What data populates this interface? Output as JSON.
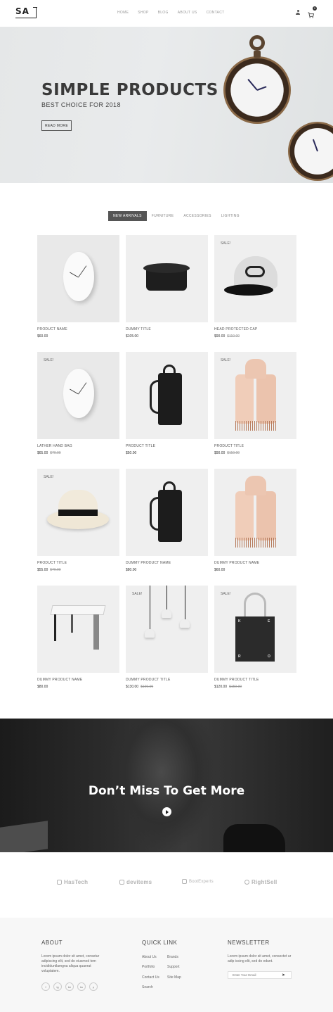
{
  "header": {
    "logo": "SA",
    "nav": [
      "HOME",
      "SHOP",
      "BLOG",
      "ABOUT US",
      "CONTACT"
    ],
    "cart_count": "0"
  },
  "hero": {
    "title": "SIMPLE PRODUCTS",
    "subtitle": "BEST CHOICE FOR 2018",
    "button": "READ MORE"
  },
  "tabs": [
    "NEW ARRIVALS",
    "FURNITURE",
    "ACCESSORIES",
    "LIGHTING"
  ],
  "products": [
    {
      "name": "PRODUCT NAME",
      "price": "$60.00",
      "old_price": "",
      "sale": "",
      "art": "clock"
    },
    {
      "name": "DUMMY TITLE",
      "price": "$105.00",
      "old_price": "",
      "sale": "",
      "art": "speaker"
    },
    {
      "name": "HEAD PROTECTED CAP",
      "price": "$90.00",
      "old_price": "$110.00",
      "sale": "SALE!",
      "art": "cap"
    },
    {
      "name": "LATHER HAND BAG",
      "price": "$65.00",
      "old_price": "$70.00",
      "sale": "SALE!",
      "art": "clock"
    },
    {
      "name": "PRODUCT TITLE",
      "price": "$50.00",
      "old_price": "",
      "sale": "",
      "art": "backpack"
    },
    {
      "name": "PRODUCT TITLE",
      "price": "$90.00",
      "old_price": "$110.00",
      "sale": "SALE!",
      "art": "scarf"
    },
    {
      "name": "PRODUCT TITLE",
      "price": "$55.00",
      "old_price": "$70.00",
      "sale": "SALE!",
      "art": "hat"
    },
    {
      "name": "DUMMY PRODUCT NAME",
      "price": "$80.00",
      "old_price": "",
      "sale": "",
      "art": "backpack"
    },
    {
      "name": "DUMMY PRODUCT NAME",
      "price": "$60.00",
      "old_price": "",
      "sale": "",
      "art": "scarf"
    },
    {
      "name": "DUMMY PRODUCT NAME",
      "price": "$80.00",
      "old_price": "",
      "sale": "",
      "art": "stool"
    },
    {
      "name": "DUMMY PRODUCT TITLE",
      "price": "$130.00",
      "old_price": "$160.00",
      "sale": "SALE!",
      "art": "lamps"
    },
    {
      "name": "DUMMY PRODUCT TITLE",
      "price": "$120.00",
      "old_price": "$150.00",
      "sale": "SALE!",
      "art": "tote"
    }
  ],
  "promo": {
    "title": "Don’t Miss To Get More"
  },
  "brands": [
    "HasTech",
    "devitems",
    "BootExperts",
    "RightSell"
  ],
  "footer": {
    "about": {
      "heading": "ABOUT",
      "text": "Lorem ipsum dolor sit amet, consetur adipiscing elit, sed do eiusmod tem incididuntlamgna aliqua quaerat voluptatem."
    },
    "quick_link": {
      "heading": "QUICK LINK",
      "col1": [
        "About Us",
        "Portfolio",
        "Contact Us",
        "Search"
      ],
      "col2": [
        "Brands",
        "Support",
        "Site Map"
      ]
    },
    "newsletter": {
      "heading": "NEWSLETTER",
      "text": "Lorem ipsum dolor sit amet, consectet ur adip iscing elit, sed do edunt.",
      "placeholder": "Enter Your Email"
    },
    "socials": [
      "f",
      "ig",
      "be",
      "tw",
      "p"
    ]
  }
}
